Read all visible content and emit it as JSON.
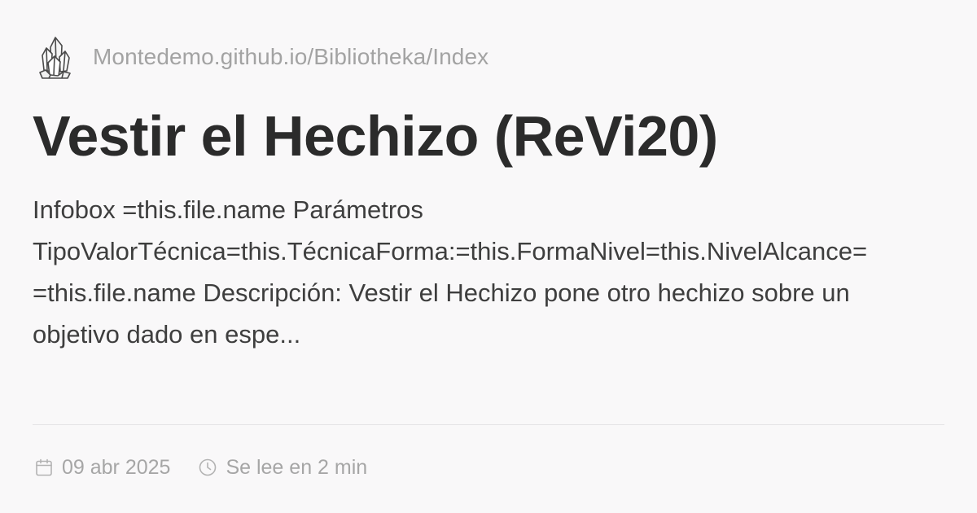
{
  "header": {
    "logo_icon": "crystal-cluster-icon",
    "site_url": "Montedemo.github.io/Bibliotheka/Index"
  },
  "article": {
    "title": "Vestir el Hechizo (ReVi20)",
    "description_lines": [
      "Infobox =this.file.name Parámetros",
      "TipoValorTécnica=this.TécnicaForma:=this.FormaNivel=this.NivelAlcance=",
      "=this.file.name Descripción: Vestir el Hechizo pone otro hechizo sobre un",
      "objetivo dado en espe..."
    ]
  },
  "meta": {
    "date_icon": "calendar-icon",
    "date": "09 abr 2025",
    "reading_icon": "clock-icon",
    "reading_time": "Se lee en 2 min"
  },
  "colors": {
    "background": "#f9f8f9",
    "title": "#2b2b2b",
    "body_text": "#3e3e3e",
    "muted_text": "#a3a3a3",
    "divider": "#e6e5e7"
  }
}
